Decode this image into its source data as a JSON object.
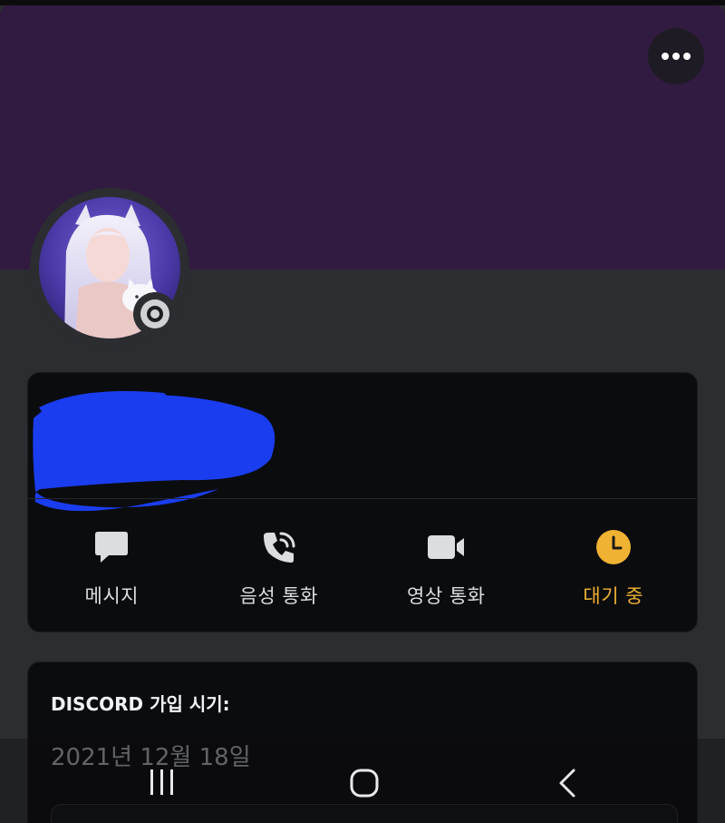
{
  "profile": {
    "status": "idle",
    "name_redacted": true
  },
  "actions": [
    {
      "id": "message",
      "label": "메시지",
      "icon": "chat-bubble-icon"
    },
    {
      "id": "voice",
      "label": "음성 통화",
      "icon": "phone-call-icon"
    },
    {
      "id": "video",
      "label": "영상 통화",
      "icon": "video-camera-icon"
    },
    {
      "id": "idle",
      "label": "대기 중",
      "icon": "clock-icon"
    }
  ],
  "member_since": {
    "title": "DISCORD 가입 시기:",
    "date": "2021년 12월 18일"
  },
  "colors": {
    "banner": "#311b41",
    "card": "#0b0c0e",
    "idle": "#f0b232",
    "redaction": "#1a3df0"
  },
  "navbar": {
    "recents_icon": "recents-icon",
    "home_icon": "home-icon",
    "back_icon": "back-icon"
  }
}
